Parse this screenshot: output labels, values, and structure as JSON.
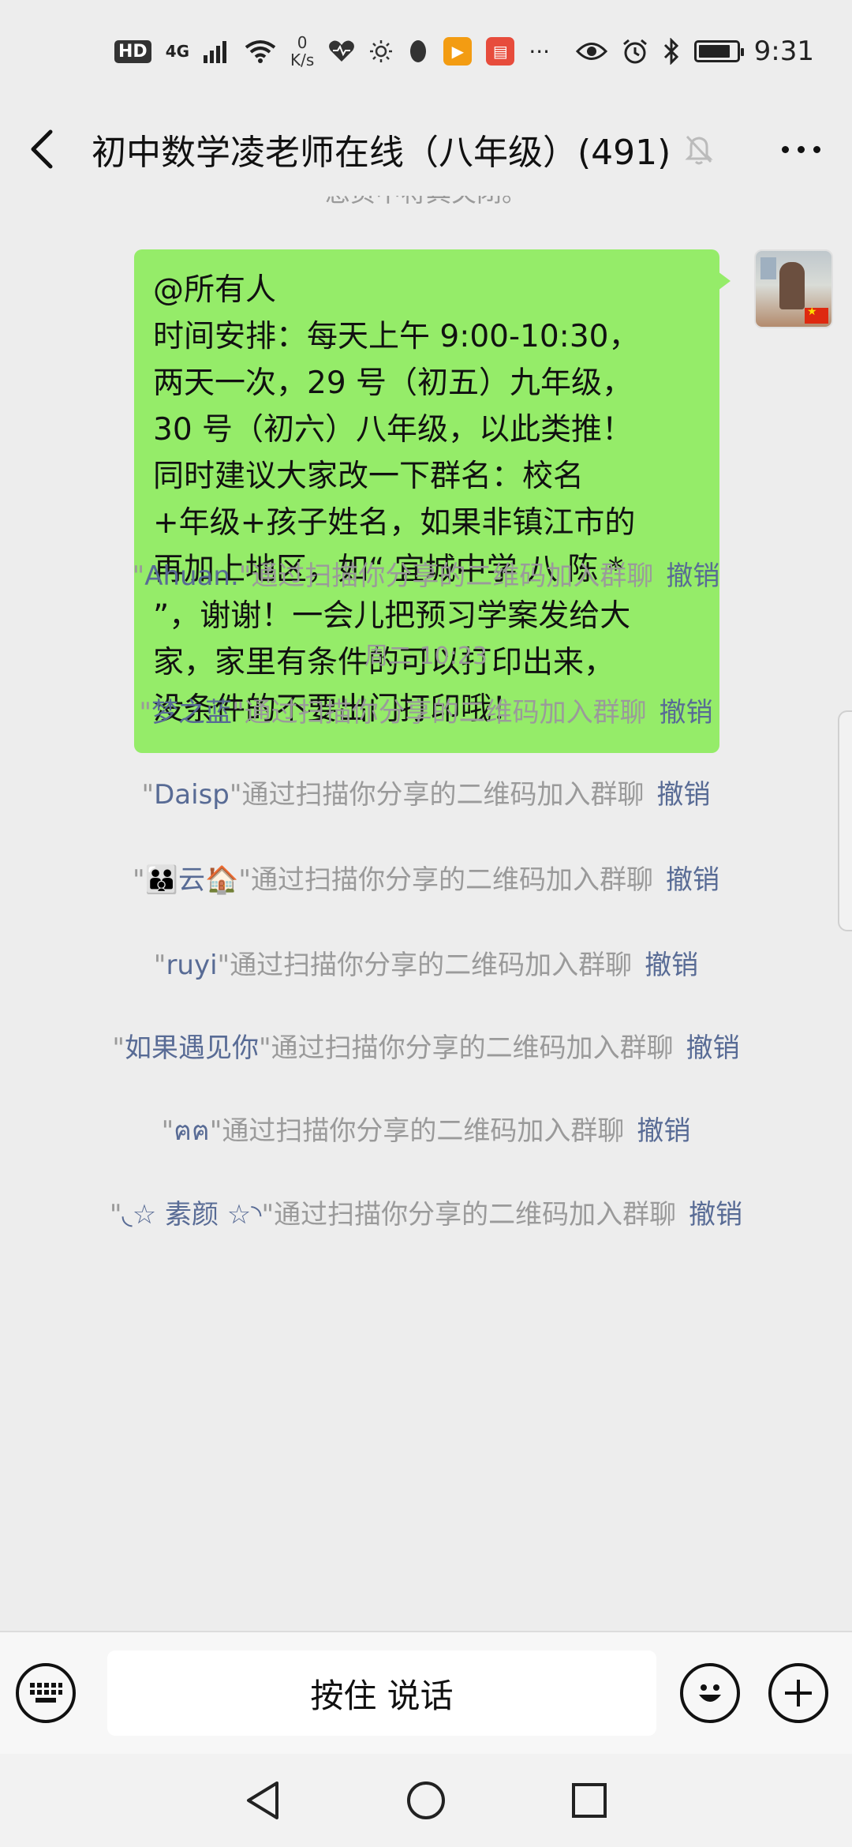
{
  "status_bar": {
    "hd": "HD",
    "signal": "4G",
    "speed_value": "0",
    "speed_unit": "K/s",
    "time": "9:31",
    "battery_level": 0.85
  },
  "header": {
    "title": "初中数学凌老师在线（八年级）(491)"
  },
  "chat": {
    "clipped_notice": "息页中将其关闭。",
    "message": {
      "lines": [
        "@所有人",
        "时间安排：每天上午 9:00-10:30，",
        "两天一次，29 号（初五）九年级，",
        "30 号（初六）八年级，以此类推！",
        "同时建议大家改一下群名：校名",
        "+年级+孩子姓名，如果非镇江市的",
        "再加上地区，如“ 宜城中学 八 陈 *",
        "”，谢谢！一会儿把预习学案发给大",
        "家，家里有条件的可以打印出来，",
        "没条件的不要出门打印哦！"
      ]
    },
    "join_text": "通过扫描你分享的二维码加入群聊",
    "undo_label": "撤销",
    "timestamp": "周二 10:23",
    "joins": [
      {
        "name": "Ahuan."
      },
      {
        "name": "梦之蓝"
      },
      {
        "name": "Daisp"
      },
      {
        "name": "👪云🏠"
      },
      {
        "name": "ruyi"
      },
      {
        "name": "如果遇见你"
      },
      {
        "name": "ฅฅ"
      },
      {
        "name": "◟☆ 素颜 ☆◝"
      }
    ]
  },
  "input_bar": {
    "hold_to_talk": "按住 说话"
  }
}
